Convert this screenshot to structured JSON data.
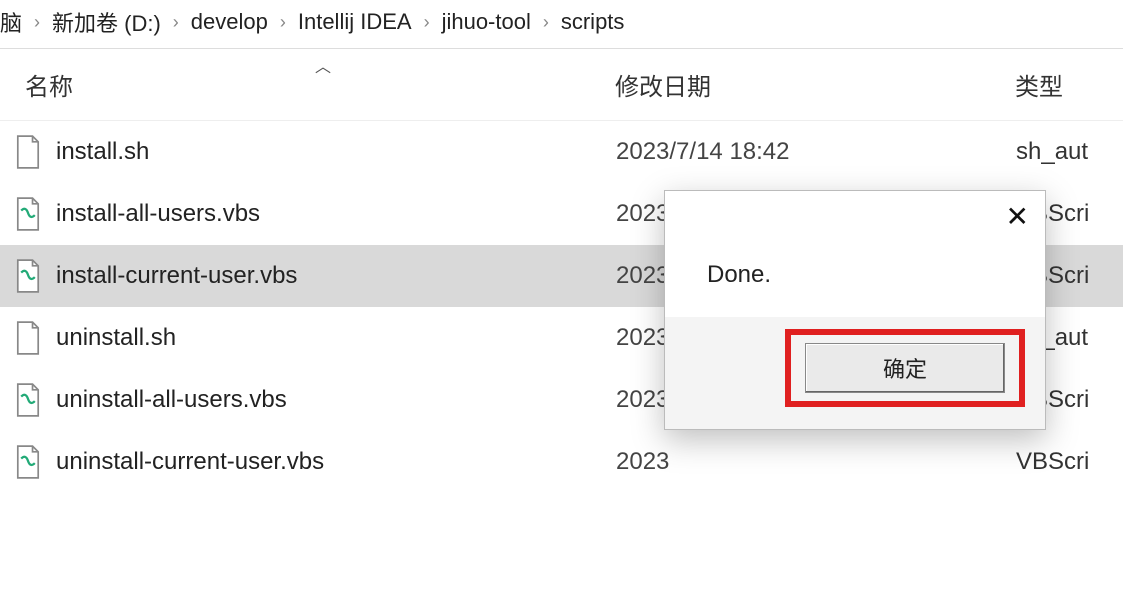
{
  "breadcrumb": {
    "part0": "脑",
    "part1": "新加卷 (D:)",
    "part2": "develop",
    "part3": "Intellij IDEA",
    "part4": "jihuo-tool",
    "part5": "scripts"
  },
  "columns": {
    "name": "名称",
    "modified": "修改日期",
    "type": "类型"
  },
  "files": [
    {
      "name": "install.sh",
      "date": "2023/7/14 18:42",
      "type": "sh_aut",
      "icon": "file"
    },
    {
      "name": "install-all-users.vbs",
      "date": "2023",
      "type": "VBScri",
      "icon": "vbs"
    },
    {
      "name": "install-current-user.vbs",
      "date": "2023",
      "type": "VBScri",
      "icon": "vbs",
      "selected": true
    },
    {
      "name": "uninstall.sh",
      "date": "2023",
      "type": "sh_aut",
      "icon": "file"
    },
    {
      "name": "uninstall-all-users.vbs",
      "date": "2023",
      "type": "VBScri",
      "icon": "vbs"
    },
    {
      "name": "uninstall-current-user.vbs",
      "date": "2023",
      "type": "VBScri",
      "icon": "vbs"
    }
  ],
  "dialog": {
    "message": "Done.",
    "ok": "确定"
  }
}
